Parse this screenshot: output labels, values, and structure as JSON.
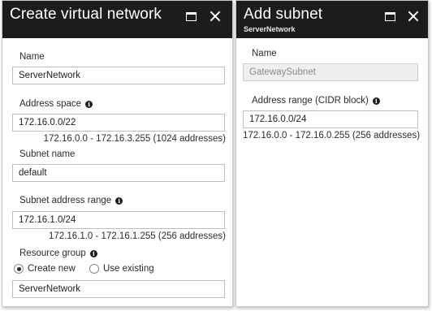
{
  "create_vnet": {
    "title": "Create virtual network",
    "name": {
      "label": "Name",
      "value": "ServerNetwork"
    },
    "address_space": {
      "label": "Address space",
      "value": "172.16.0.0/22",
      "hint": "172.16.0.0 - 172.16.3.255 (1024 addresses)"
    },
    "subnet_name": {
      "label": "Subnet name",
      "value": "default"
    },
    "subnet_range": {
      "label": "Subnet address range",
      "value": "172.16.1.0/24",
      "hint": "172.16.1.0 - 172.16.1.255 (256 addresses)"
    },
    "resource_group": {
      "label": "Resource group",
      "options": [
        {
          "label": "Create new",
          "selected": true
        },
        {
          "label": "Use existing",
          "selected": false
        }
      ],
      "value": "ServerNetwork"
    }
  },
  "add_subnet": {
    "title": "Add subnet",
    "subtitle": "ServerNetwork",
    "name": {
      "label": "Name",
      "value": "GatewaySubnet"
    },
    "address_range": {
      "label": "Address range (CIDR block)",
      "value": "172.16.0.0/24",
      "hint": "172.16.0.0 - 172.16.0.255 (256 addresses)"
    }
  },
  "icons": {
    "maximize": "maximize-icon",
    "close": "close-icon",
    "info": "info-icon"
  }
}
